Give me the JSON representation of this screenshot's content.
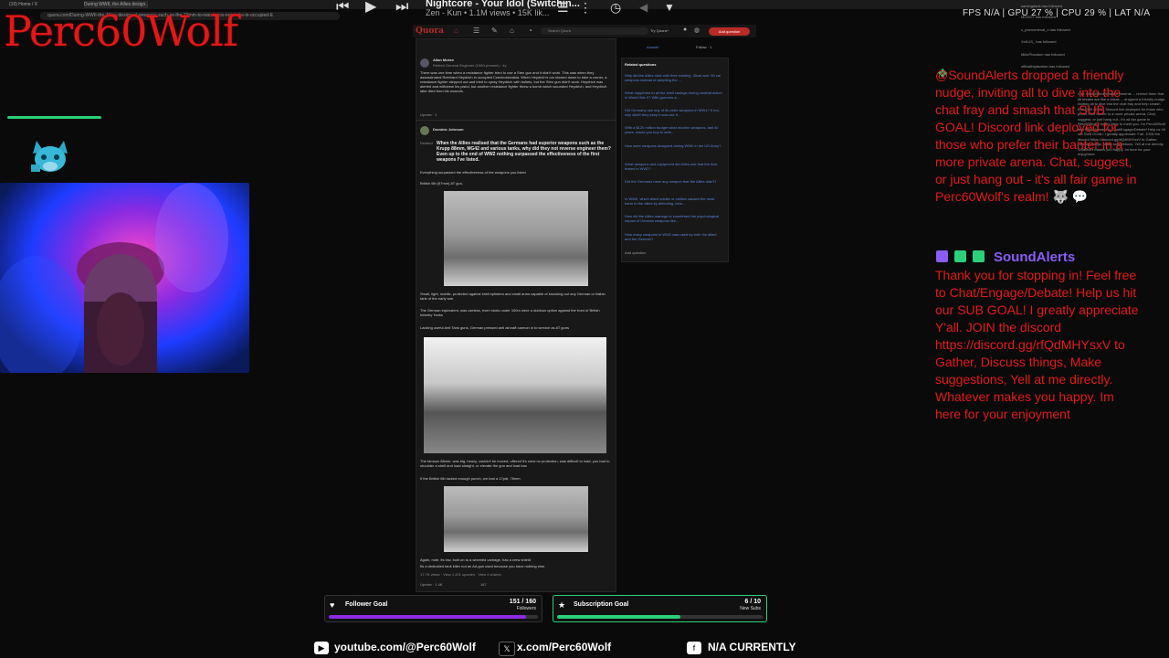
{
  "browser": {
    "tabs": [
      "(10) Home / X",
      "During WWII, the Allies design...",
      "Quora"
    ],
    "address": "quora.com/During-WWII-the-Allies-designed-weapons-such-as-the-19mm-to-resistance-networks-in-occupied-E"
  },
  "overlay": {
    "streamer_name": "Perc60Wolf",
    "colors": {
      "accent_red": "#e01818",
      "accent_green": "#2bd07a",
      "accent_purple": "#8a5cf5"
    }
  },
  "media": {
    "title": "Nightcore - Your Idol (Switchin...",
    "subtitle": "Zen - Kun • 1.1M views • 15K lik...",
    "icons": [
      "prev-icon",
      "play-icon",
      "next-icon",
      "queue-icon",
      "more-icon",
      "timer-icon",
      "back-icon",
      "dropdown-icon"
    ]
  },
  "stats": {
    "text": "FPS N/A | GPU 27 % | CPU 29 % | LAT N/A"
  },
  "quora": {
    "logo": "Quora",
    "search_placeholder": "Search Quora",
    "try_quora": "Try Quora+",
    "add_question": "Add question",
    "answer_label": "Answer",
    "follow_label": "Follow · 1",
    "post1": {
      "author": "Allan Mckee",
      "credential": "Retired General Engineer (1960-present) · 4y",
      "body": "There was one time when a resistance fighter tried to use a Sten gun and it didn't work. This was when they assassinated Reinhard Heydrich in occupied Czechoslovakia. When Heydrich's car slowed down to take a corner, a resistance fighter stepped out and tried to spray Heydrich with bullets, but the Sten gun didn't work. Heydrich was alerted and withdrew his pistol, but another resistance fighter threw a bomb which wounded Heydrich, and Heydrich later died from his wounds.",
      "upvote": "Upvote · 1"
    },
    "post2": {
      "author": "Dominic Johnson",
      "related": "Related",
      "question": "When the Allies realised that the Germans had superior weapons such as the Krupp 88mm, MG42 and various tanks, why did they not reverse engineer them? Even up to the end of WW2 nothing surpassed the effectiveness of the first weapons I've listed.",
      "lead": "Everything surpassed the effectiveness of the weapons you listed",
      "gun1": "British 6lb (57mm) AT gun,",
      "p1": "Small, light, mobile, protected against shell splinters and small arms capable of knocking out any German or Italian tank of the early war.",
      "p2": "The German equivalent, was useless, even shots under 100m were a dubious option against the front of British Infantry Tanks",
      "p3": "Lacking useful Anti Tank guns, German pressed anti aircraft cannon in to service as AT guns",
      "p4": "The famous 88mm, was big, heavy, couldn't be moved, offered it's crew no protection, was difficult to load, you had to shoulder a shell and load straight, or elevate the gun and load low.",
      "p5": "If the British 6lb lacked enough punch, we had a 17pdr, 76mm",
      "p6": "Again, note, its low, built on to a wheeled carriage, has a crew shield",
      "p7": "Its a dedicated tank killer not an AA gun used because you have nothing else.",
      "footer": "17.7K views · View 1,401 upvotes · View 4 shares",
      "upvote": "Upvote · 1.4K",
      "comments": "187"
    },
    "related": {
      "title": "Related questions",
      "items": [
        "Why did the Allies stick with their existing .30cal and .50 cal weapons instead of adopting the ...",
        "What happened to all the shell casings during combat action in World War II? With gunners a...",
        "Did Germany use any of its older weapons in WW1? If not, why didn't they keep it and use it...",
        "With a $120 million budget what modern weapons, last 40 years, would you buy to defe...",
        "How were weapons designed during WWII in the US Army?",
        "What weapons and equipment did Allies use that the Axis feared in WW2?",
        "Did the Germans have any weapon that the Allies didn't?",
        "In WW2, which allied soldier or civilian caused the most harm to the allies by defecting, bein...",
        "How did the Allies manage to counteract the psychological impact of German weapons like...",
        "How many weapons in WW2 was used by both the allied and the German?"
      ],
      "add": "Add question"
    }
  },
  "chat": {
    "message1": "@SoundAlerts dropped a friendly nudge, inviting all to dive into the chat fray and smash that SUB GOAL! Discord link deployed for those who prefer their banter in a more private arena. Chat, suggest, or just hang out - it's all fair game in Perc60Wolf's realm! 🐺 💬",
    "sound_alerts_name": "SoundAlerts",
    "message2": "Thank you for stopping in! Feel free to Chat/Engage/Debate! Help us hit our SUB GOAL! I greatly appreciate Y'all. JOIN the discord https://discord.gg/rfQdMHYsxV to Gather, Discuss things, Make suggestions, Yell at me directly. Whatever makes you happy. Im here for your enjoyment"
  },
  "follow_list": [
    "samingdadx has followed",
    "MUSGY has followed",
    "x_phenomenal_x has followed",
    "XxKUS_ has followed",
    "MikePhantom has followed",
    "officialbigfacetan has followed"
  ],
  "side_chat": "Clip: Perc60Wolf's best moments ... remind them that all breaks are like a break ... dropped a friendly nudge, inviting all to dive into the chat fray and help smash that SUB GOAL! Discord link deployed for those who prefer their banter in a more private arena. Chat, suggest, or just hang out - it's all fair game in Perc60Wolf's realm! Nice to meet you. I'm Perc60Wolf and I look forward to Chat/Engage/Debate! Help us hit our SUB GOAL! I greatly appreciate Y'all. JOIN the discord https://discord.gg/rfQdMHYsxV to Gather, Discuss things, Make suggestions, Yell at me directly. Whatever makes you happy. Im here for your enjoyment",
  "goals": {
    "follower": {
      "label": "Follower Goal",
      "count": "151 / 160",
      "unit": "Followers",
      "progress": 0.944,
      "color": "#8a2be2"
    },
    "subscription": {
      "label": "Subscription Goal",
      "count": "6 / 10",
      "unit": "New Subs",
      "progress": 0.6,
      "color": "#2bd07a"
    }
  },
  "socials": {
    "youtube": "youtube.com/@Perc60Wolf",
    "x": "x.com/Perc60Wolf",
    "facebook": "N/A CURRENTLY"
  }
}
